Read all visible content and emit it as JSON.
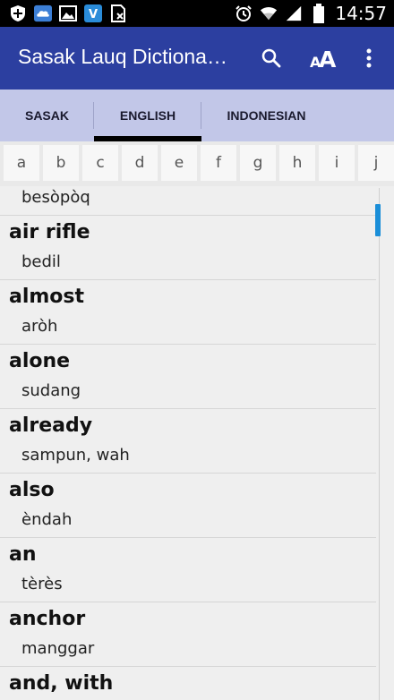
{
  "statusbar": {
    "time": "14:57",
    "left_icons": [
      "shield-icon",
      "cloud-weather-icon",
      "image-icon",
      "voice-app-icon",
      "sim-x-icon"
    ],
    "right_icons": [
      "alarm-icon",
      "wifi-icon",
      "signal-icon",
      "battery-icon"
    ]
  },
  "appbar": {
    "title": "Sasak Lauq Dictiona…",
    "actions": [
      "search-icon",
      "font-size-icon",
      "overflow-menu-icon"
    ]
  },
  "tabs": [
    {
      "label": "SASAK",
      "active": false
    },
    {
      "label": "ENGLISH",
      "active": true
    },
    {
      "label": "INDONESIAN",
      "active": false
    }
  ],
  "alphabet": [
    "a",
    "b",
    "c",
    "d",
    "e",
    "f",
    "g",
    "h",
    "i",
    "j"
  ],
  "entries": [
    {
      "word": "–",
      "def": "besòpòq"
    },
    {
      "word": "air rifle",
      "def": "bedil"
    },
    {
      "word": "almost",
      "def": "aròh"
    },
    {
      "word": "alone",
      "def": "sudang"
    },
    {
      "word": "already",
      "def": "sampun, wah"
    },
    {
      "word": "also",
      "def": "èndah"
    },
    {
      "word": "an",
      "def": "tèrès"
    },
    {
      "word": "anchor",
      "def": "manggar"
    },
    {
      "word": "and, with",
      "def": ""
    }
  ],
  "colors": {
    "appbar": "#2c3fa0",
    "tabs_bg": "#c2c7e8",
    "scroll_thumb": "#1a8ed8"
  }
}
